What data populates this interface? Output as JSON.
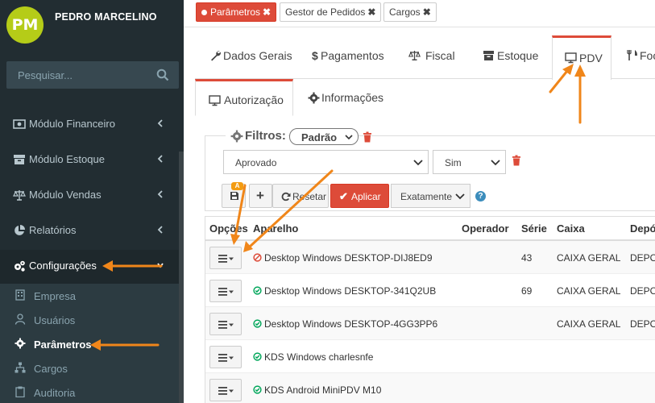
{
  "user": {
    "initials": "PM",
    "name": "PEDRO MARCELINO"
  },
  "search": {
    "placeholder": "Pesquisar..."
  },
  "sidebar": {
    "items": [
      {
        "label": "Módulo Financeiro"
      },
      {
        "label": "Módulo Estoque"
      },
      {
        "label": "Módulo Vendas"
      },
      {
        "label": "Relatórios"
      },
      {
        "label": "Configurações"
      }
    ],
    "subitems": [
      {
        "label": "Empresa"
      },
      {
        "label": "Usuários"
      },
      {
        "label": "Parâmetros"
      },
      {
        "label": "Cargos"
      },
      {
        "label": "Auditoria"
      }
    ]
  },
  "top_tabs": [
    {
      "label": "Parâmetros"
    },
    {
      "label": "Gestor de Pedidos"
    },
    {
      "label": "Cargos"
    }
  ],
  "nav_tabs": [
    {
      "label": "Dados Gerais"
    },
    {
      "label": "Pagamentos"
    },
    {
      "label": "Fiscal"
    },
    {
      "label": "Estoque"
    },
    {
      "label": "PDV"
    },
    {
      "label": "Foo"
    }
  ],
  "sub_tabs": [
    {
      "label": "Autorização"
    },
    {
      "label": "Informações"
    }
  ],
  "filters": {
    "title": "Filtros:",
    "preset": "Padrão",
    "field_value": "Aprovado",
    "condition_value": "Sim",
    "badge": "A",
    "reset_label": "Resetar",
    "apply_label": "Aplicar",
    "match_value": "Exatamente",
    "help": "?"
  },
  "table": {
    "headers": [
      "Opções",
      "Aparelho",
      "Operador",
      "Série",
      "Caixa",
      "Depós"
    ],
    "rows": [
      {
        "device": "Desktop Windows DESKTOP-DIJ8ED9",
        "operator": "",
        "serie": "43",
        "caixa": "CAIXA GERAL",
        "deposito": "DEPO",
        "status": "blocked"
      },
      {
        "device": "Desktop Windows DESKTOP-341Q2UB",
        "operator": "",
        "serie": "69",
        "caixa": "CAIXA GERAL",
        "deposito": "DEPO",
        "status": "ok"
      },
      {
        "device": "Desktop Windows DESKTOP-4GG3PP6",
        "operator": "",
        "serie": "",
        "caixa": "CAIXA GERAL",
        "deposito": "DEPO",
        "status": "ok"
      },
      {
        "device": "KDS Windows charlesnfe",
        "operator": "",
        "serie": "",
        "caixa": "",
        "deposito": "",
        "status": "ok"
      },
      {
        "device": "KDS Android MiniPDV M10",
        "operator": "",
        "serie": "",
        "caixa": "",
        "deposito": "",
        "status": "ok"
      }
    ]
  },
  "colors": {
    "sidebar_bg": "#222d32",
    "accent_red": "#dd4b39",
    "status_ok": "#00a65a",
    "annotation_arrow": "#f0861a",
    "avatar": "#b5cc18"
  }
}
